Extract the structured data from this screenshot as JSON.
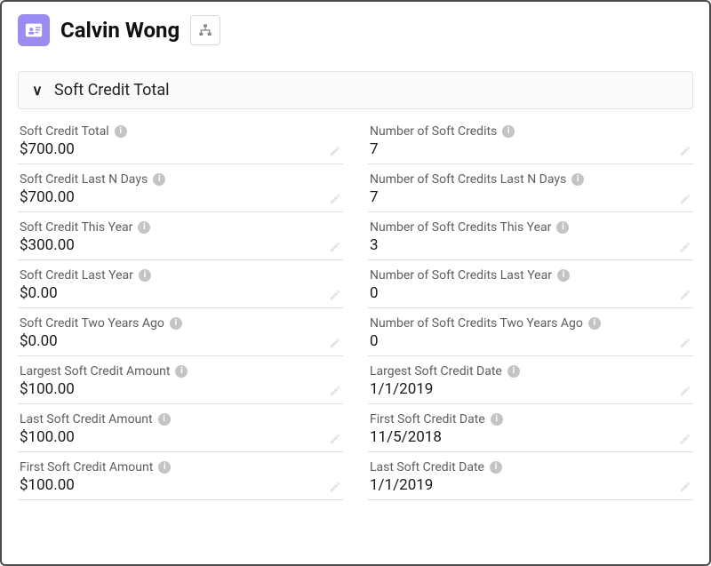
{
  "header": {
    "record_name": "Calvin Wong"
  },
  "section": {
    "title": "Soft Credit Total"
  },
  "left_fields": [
    {
      "label": "Soft Credit Total",
      "value": "$700.00"
    },
    {
      "label": "Soft Credit Last N Days",
      "value": "$700.00"
    },
    {
      "label": "Soft Credit This Year",
      "value": "$300.00"
    },
    {
      "label": "Soft Credit Last Year",
      "value": "$0.00"
    },
    {
      "label": "Soft Credit Two Years Ago",
      "value": "$0.00"
    },
    {
      "label": "Largest Soft Credit Amount",
      "value": "$100.00"
    },
    {
      "label": "Last Soft Credit Amount",
      "value": "$100.00"
    },
    {
      "label": "First Soft Credit Amount",
      "value": "$100.00"
    }
  ],
  "right_fields": [
    {
      "label": "Number of Soft Credits",
      "value": "7"
    },
    {
      "label": "Number of Soft Credits Last N Days",
      "value": "7"
    },
    {
      "label": "Number of Soft Credits This Year",
      "value": "3"
    },
    {
      "label": "Number of Soft Credits Last Year",
      "value": "0"
    },
    {
      "label": "Number of Soft Credits Two Years Ago",
      "value": "0"
    },
    {
      "label": "Largest Soft Credit Date",
      "value": "1/1/2019"
    },
    {
      "label": "First Soft Credit Date",
      "value": "11/5/2018"
    },
    {
      "label": "Last Soft Credit Date",
      "value": "1/1/2019"
    }
  ]
}
